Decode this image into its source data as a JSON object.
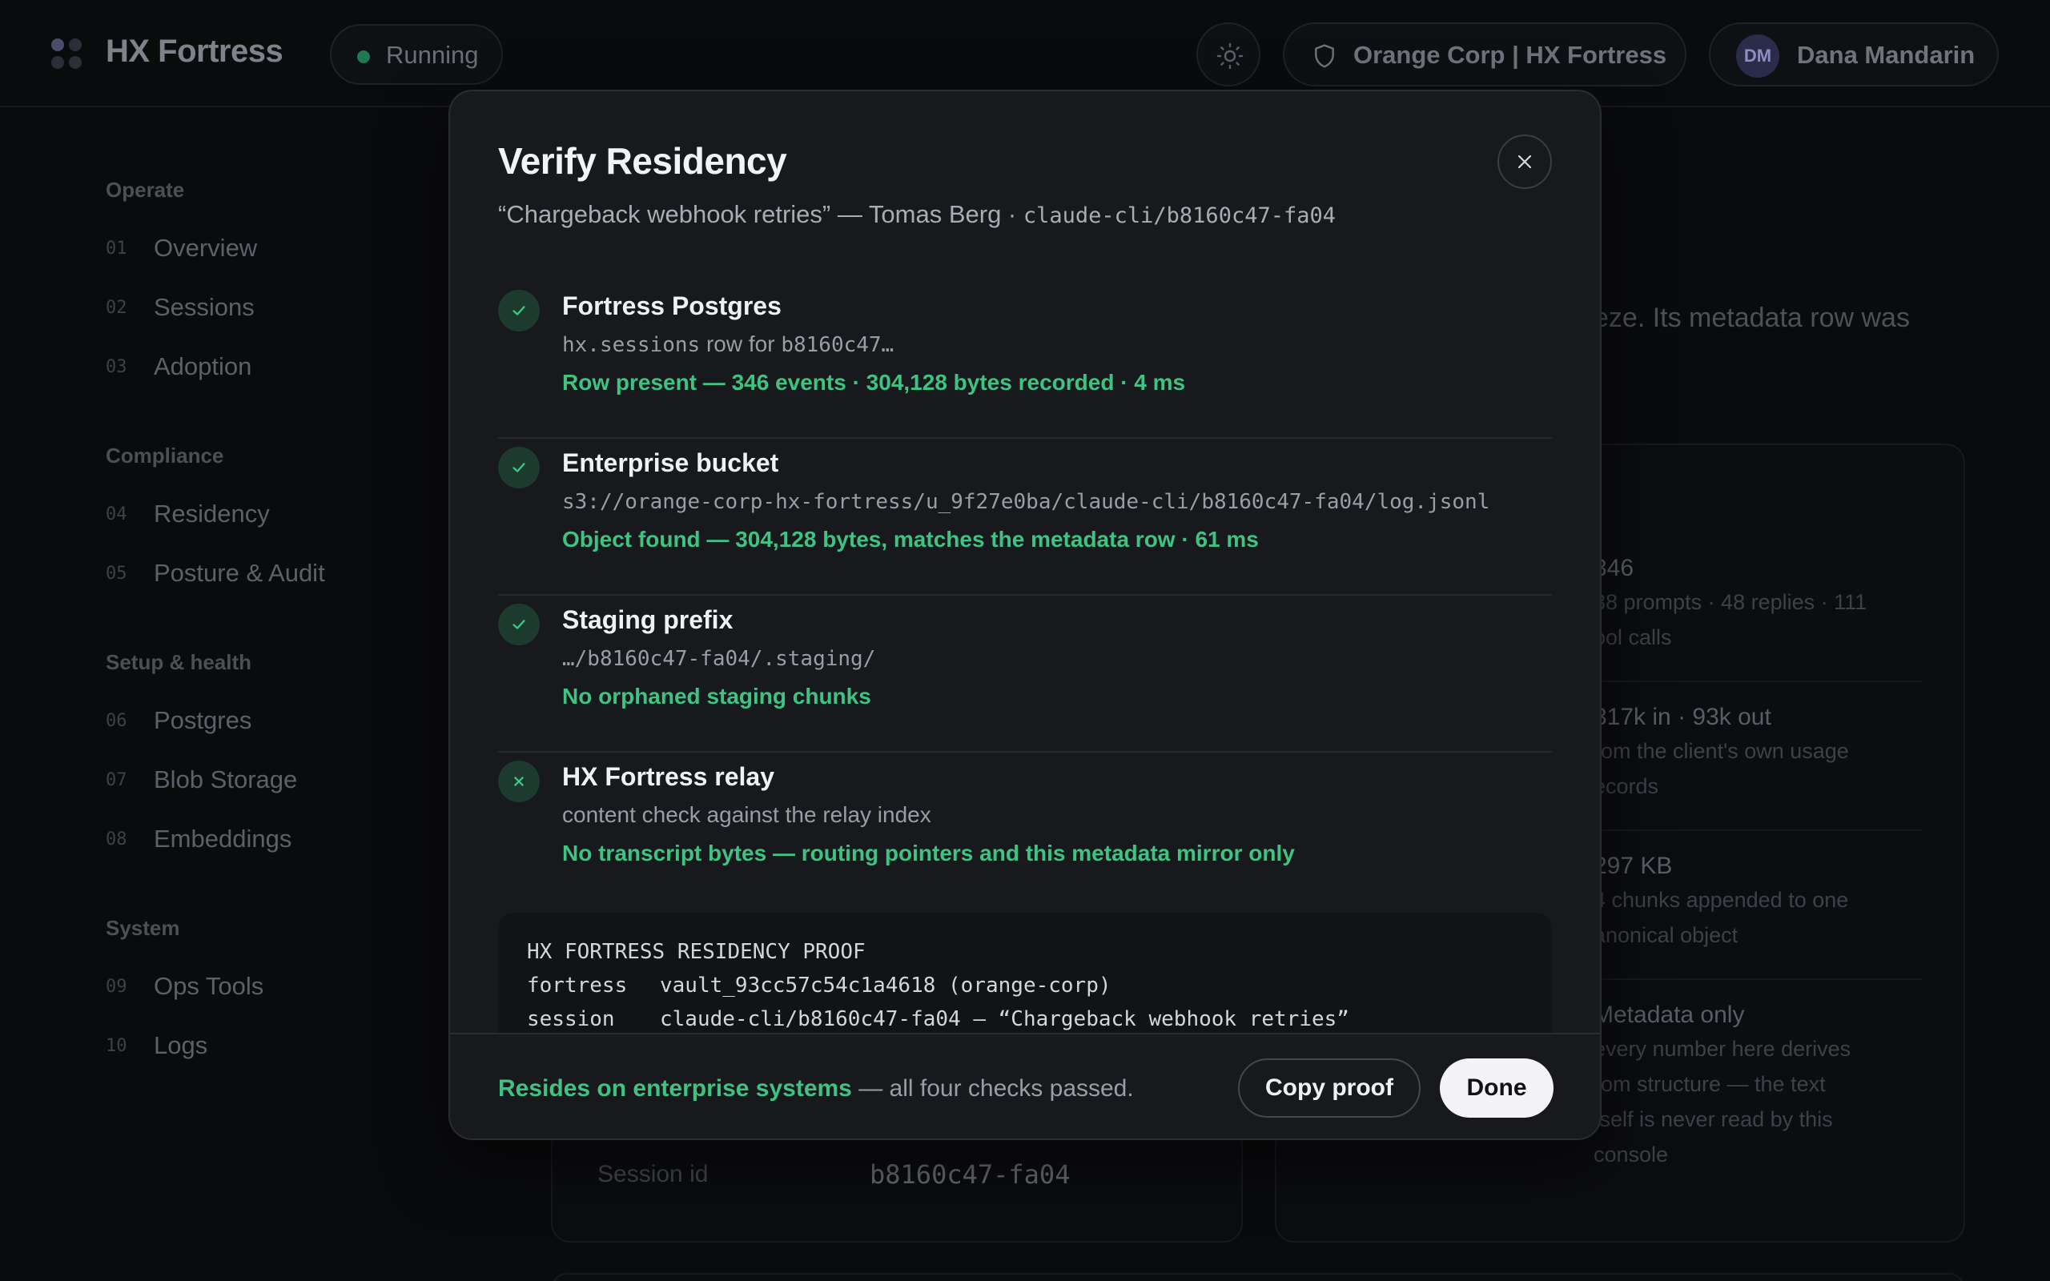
{
  "header": {
    "brand": "HX Fortress",
    "status": "Running",
    "org": "Orange Corp | HX Fortress",
    "user_initials": "DM",
    "user_name": "Dana Mandarin",
    "theme_icon": "sun-icon",
    "org_icon": "shield-icon"
  },
  "sidebar": {
    "groups": [
      {
        "title": "Operate",
        "items": [
          {
            "num": "01",
            "label": "Overview"
          },
          {
            "num": "02",
            "label": "Sessions"
          },
          {
            "num": "03",
            "label": "Adoption"
          }
        ]
      },
      {
        "title": "Compliance",
        "items": [
          {
            "num": "04",
            "label": "Residency"
          },
          {
            "num": "05",
            "label": "Posture & Audit"
          }
        ]
      },
      {
        "title": "Setup & health",
        "items": [
          {
            "num": "06",
            "label": "Postgres"
          },
          {
            "num": "07",
            "label": "Blob Storage"
          },
          {
            "num": "08",
            "label": "Embeddings"
          }
        ]
      },
      {
        "title": "System",
        "items": [
          {
            "num": "09",
            "label": "Ops Tools"
          },
          {
            "num": "10",
            "label": "Logs"
          }
        ]
      }
    ]
  },
  "background": {
    "intro_fragment": "eze. Its metadata row was",
    "stats": [
      {
        "title": "346",
        "sub1": "38 prompts · 48 replies · 111",
        "sub2": "ool calls"
      },
      {
        "title": "317k in · 93k out",
        "sub1": "rom the client's own usage",
        "sub2": "ecords"
      },
      {
        "title": "297 KB",
        "sub1": "4 chunks appended to one",
        "sub2": "anonical object"
      },
      {
        "title": "Metadata only",
        "sub1": "every number here derives",
        "sub2": "rom structure — the text",
        "sub3": "tself is never read by this",
        "sub4": "console"
      }
    ],
    "session_label": "Session id",
    "session_value": "b8160c47-fa04"
  },
  "modal": {
    "title": "Verify Residency",
    "subtitle_text": "“Chargeback webhook retries” — Tomas Berg · ",
    "subtitle_code": "claude-cli/b8160c47-fa04",
    "checks": [
      {
        "title": "Fortress Postgres",
        "detail_code": "hx.sessions",
        "detail_text": " row for ",
        "detail_code2": "b8160c47…",
        "result": "Row present — 346 events · 304,128 bytes recorded · 4 ms",
        "status": "pass"
      },
      {
        "title": "Enterprise bucket",
        "detail_code": "s3://orange-corp-hx-fortress/u_9f27e0ba/claude-cli/b8160c47-fa04/log.jsonl",
        "result": "Object found — 304,128 bytes, matches the metadata row · 61 ms",
        "status": "pass"
      },
      {
        "title": "Staging prefix",
        "detail_code": "…/b8160c47-fa04/.staging/",
        "result": "No orphaned staging chunks",
        "status": "pass"
      },
      {
        "title": "HX Fortress relay",
        "detail_text": "content check against the relay index",
        "result": "No transcript bytes — routing pointers and this metadata mirror only",
        "status": "pass-absent"
      }
    ],
    "proof": {
      "heading": "HX FORTRESS RESIDENCY PROOF",
      "lines": [
        {
          "key": "fortress",
          "value": "vault_93cc57c54c1a4618 (orange-corp)"
        },
        {
          "key": "session",
          "value": "claude-cli/b8160c47-fa04 — “Chargeback webhook retries”"
        }
      ]
    },
    "footer": {
      "ok_text": "Resides on enterprise systems",
      "rest_text": " — all four checks passed.",
      "copy_label": "Copy proof",
      "done_label": "Done"
    },
    "colors": {
      "accent_green": "#3fc282",
      "check_bg": "#1c3a2d"
    }
  }
}
